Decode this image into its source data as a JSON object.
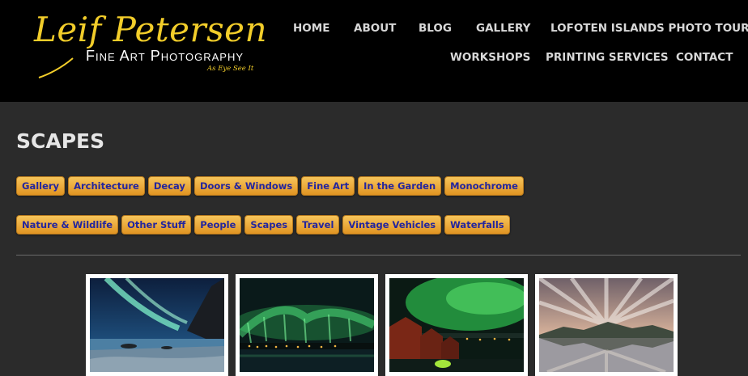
{
  "site": {
    "logo_script": "Leif Petersen",
    "logo_subtitle": "Fine Art Photography",
    "logo_tagline": "As Eye See It",
    "brand_color": "#f2cd2a"
  },
  "nav": {
    "home": "HOME",
    "about": "ABOUT",
    "blog": "BLOG",
    "gallery": "GALLERY",
    "lofoten": "LOFOTEN ISLANDS PHOTO TOURS",
    "workshops": "WORKSHOPS",
    "printing": "PRINTING SERVICES",
    "contact": "CONTACT"
  },
  "page": {
    "title": "SCAPES"
  },
  "categories": {
    "row1": [
      "Gallery",
      "Architecture",
      "Decay",
      "Doors & Windows",
      "Fine Art",
      "In the Garden",
      "Monochrome"
    ],
    "row2": [
      "Nature & Wildlife",
      "Other Stuff",
      "People",
      "Scapes",
      "Travel",
      "Vintage Vehicles",
      "Waterfalls"
    ]
  },
  "colors": {
    "button_top": "#f6c45a",
    "button_bottom": "#e19422",
    "button_text": "#23259e",
    "background": "#2b2b2b",
    "header": "#000000"
  }
}
